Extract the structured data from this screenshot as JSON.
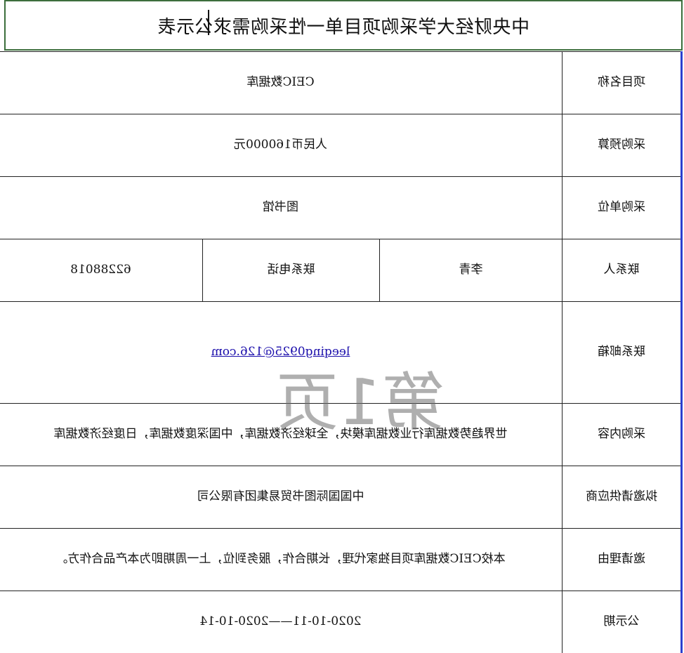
{
  "title": "中央财经大学采购项目单一性采购需求公示表",
  "watermark": "第1页",
  "rows": {
    "project_name": {
      "label": "项目名称",
      "value": "CEIC数据库"
    },
    "budget": {
      "label": "采购预算",
      "value": "人民币160000元"
    },
    "unit": {
      "label": "采购单位",
      "value": "图书馆"
    },
    "contact": {
      "label": "联系人",
      "name": "李青",
      "phone_label": "联系电话",
      "phone": "62288018"
    },
    "email": {
      "label": "联系邮箱",
      "value": "leeqing0925@126.com"
    },
    "content": {
      "label": "采购内容",
      "value": "世界趋势数据库行业数据库模块，全球经济数据库，中国深度数据库，日度经济数据库"
    },
    "supplier": {
      "label": "拟邀请供应商",
      "value": "中国国际图书贸易集团有限公司"
    },
    "reason": {
      "label": "邀请理由",
      "value": "本校CEIC数据库项目独家代理，长期合作，服务到位，上一周期即为本产品合作方。"
    },
    "period": {
      "label": "公示期",
      "value": "2020-10-11——2020-10-14"
    }
  },
  "colors": {
    "title_border": "#3c6e3c",
    "label_edge": "#2b3fcf",
    "link": "#1a0dab"
  }
}
